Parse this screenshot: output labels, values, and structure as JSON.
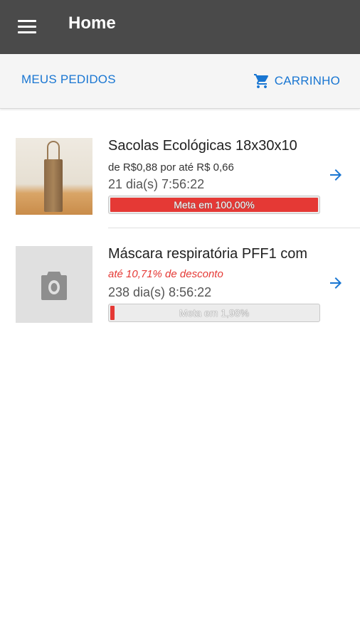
{
  "appbar": {
    "title": "Home",
    "menu_icon": "menu-icon"
  },
  "toolbar": {
    "orders_label": "MEUS PEDIDOS",
    "cart_label": "CARRINHO",
    "cart_icon": "shopping-cart-icon",
    "accent_color": "#1976d2"
  },
  "products": [
    {
      "name": "Sacolas Ecológicas 18x30x10",
      "price_text": "de R$0,88 por até R$ 0,66",
      "timer": "21 dia(s) 7:56:22",
      "goal_label": "Meta em 100,00%",
      "goal_percent": 100,
      "image": "product-photo"
    },
    {
      "name": "Máscara respiratória PFF1 com",
      "discount_text": "até 10,71% de desconto",
      "timer": "238 dia(s) 8:56:22",
      "goal_label": "Meta em 1,98%",
      "goal_percent": 1.98,
      "image": "camera-icon"
    }
  ],
  "colors": {
    "appbar": "#4a4a4a",
    "progress": "#e53935",
    "discount": "#e53935"
  }
}
